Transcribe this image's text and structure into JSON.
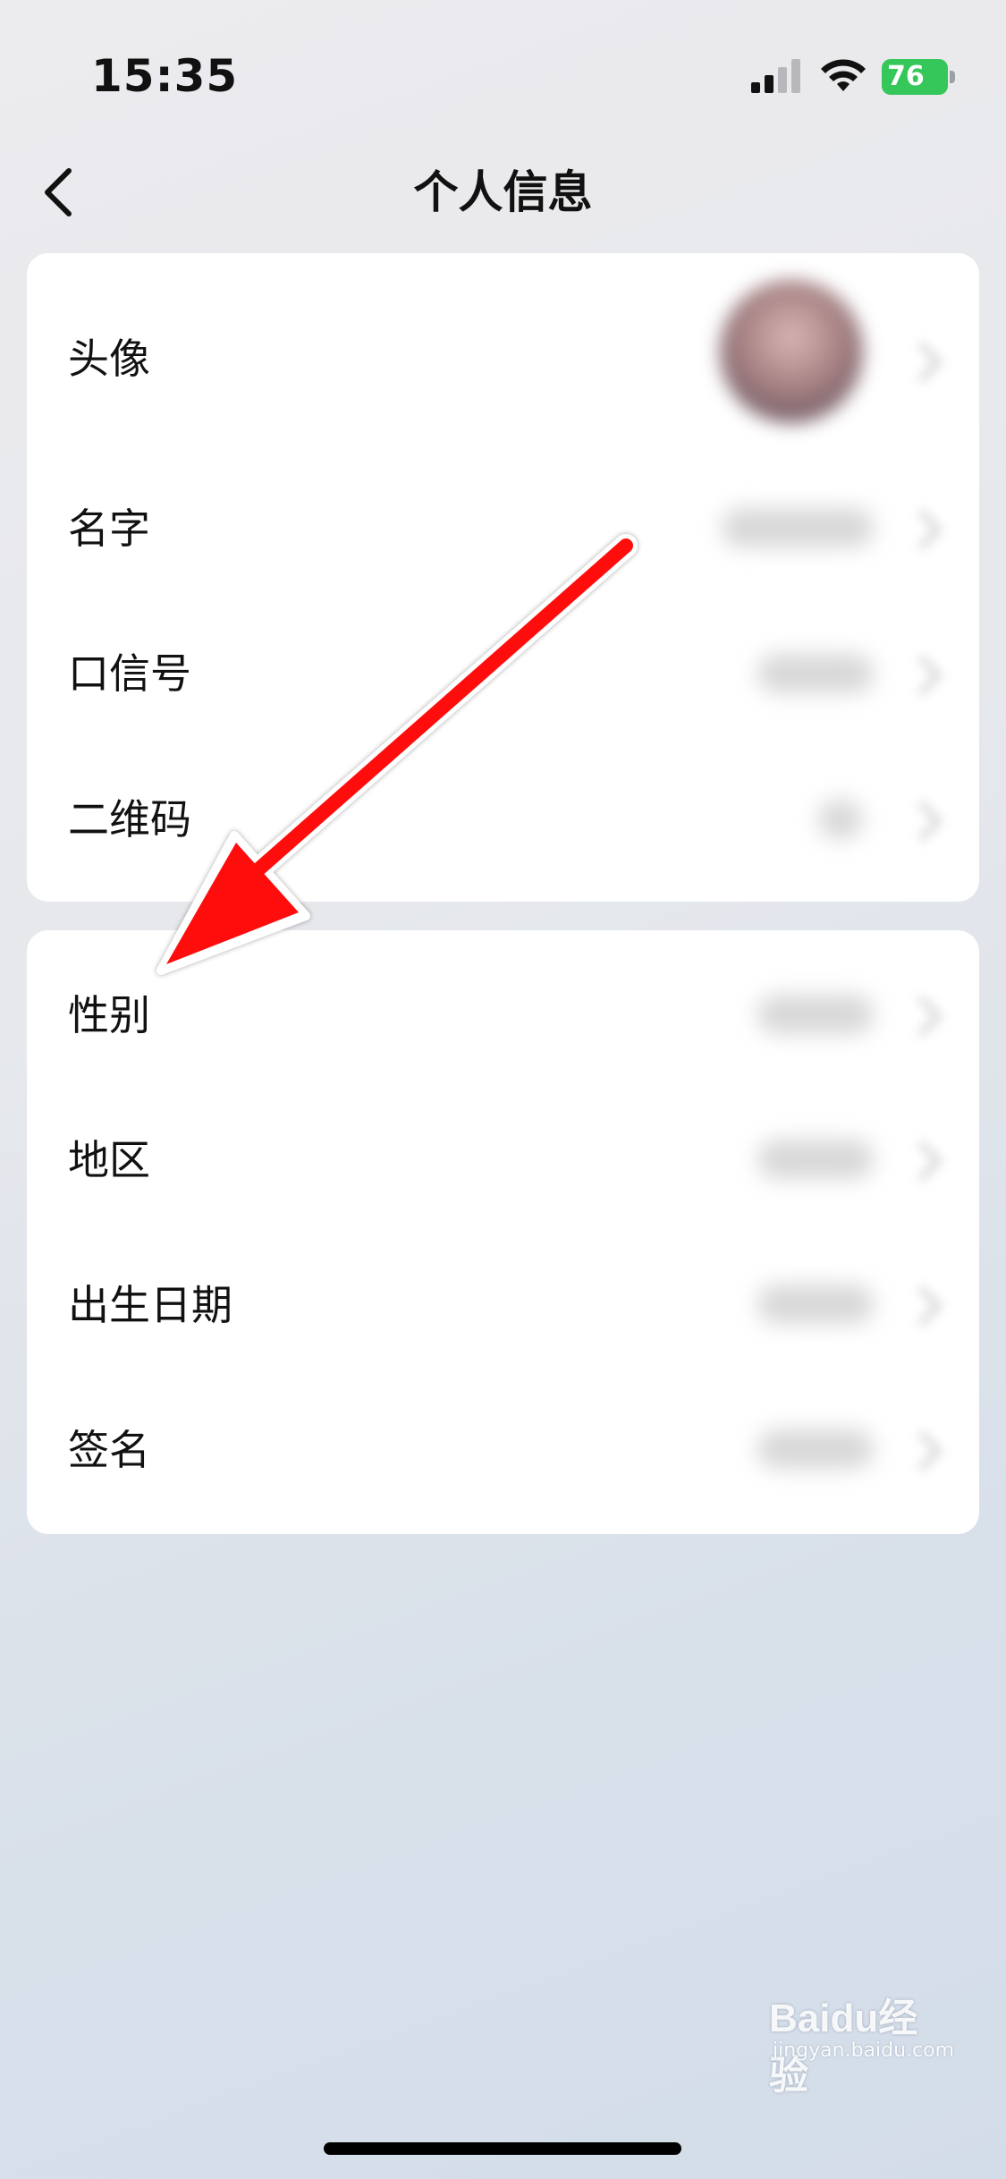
{
  "status_bar": {
    "time": "15:35",
    "battery": "76",
    "battery_color": "#35c759"
  },
  "nav": {
    "back_icon": "chevron-left-icon",
    "title": "个人信息"
  },
  "card_1": {
    "rows": [
      {
        "label": "头像"
      },
      {
        "label": "名字"
      },
      {
        "label": "口信号"
      },
      {
        "label": "二维码"
      }
    ]
  },
  "card_2": {
    "rows": [
      {
        "label": "性别"
      },
      {
        "label": "地区"
      },
      {
        "label": "出生日期"
      },
      {
        "label": "签名"
      }
    ]
  },
  "annotation": {
    "type": "red-arrow",
    "color": "#ff1010"
  },
  "watermark": {
    "logo": "Baidu经验",
    "sub": "jingyan.baidu.com"
  }
}
